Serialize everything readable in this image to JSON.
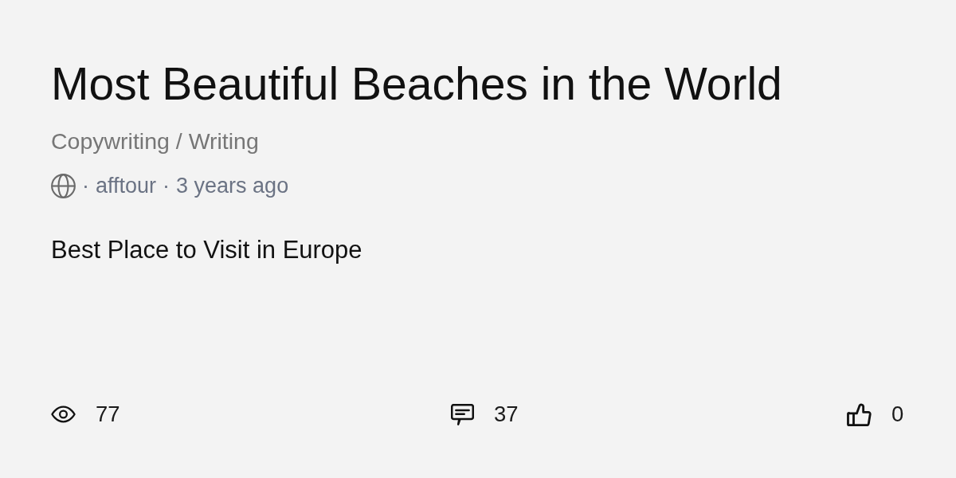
{
  "title": "Most Beautiful Beaches in the World",
  "category": "Copywriting / Writing",
  "meta": [
    {
      "separator": "·",
      "text": "afftour"
    },
    {
      "separator": "·",
      "text": "3 years ago"
    }
  ],
  "description": "Best Place to Visit in Europe",
  "stats": [
    {
      "kind": "views",
      "count": "77"
    },
    {
      "kind": "comments",
      "count": "37"
    },
    {
      "kind": "likes",
      "count": "0"
    }
  ]
}
